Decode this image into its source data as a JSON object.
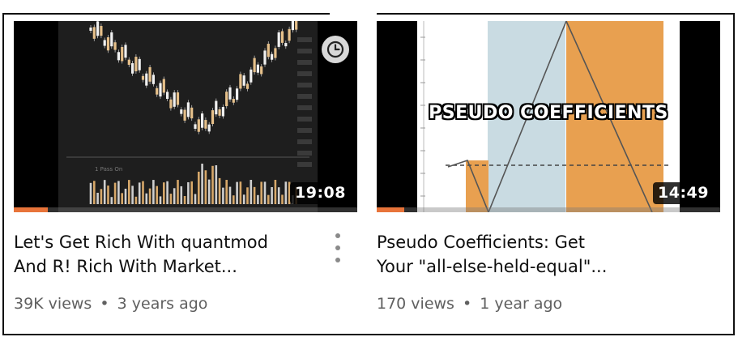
{
  "videos": [
    {
      "duration": "19:08",
      "title_line1": "Let's Get Rich With quantmod",
      "title_line2": "And R! Rich With Market...",
      "views": "39K views",
      "separator": "•",
      "age": "3 years ago",
      "watch_progress": 0.1,
      "chart_label": "1 Pass On"
    },
    {
      "duration": "14:49",
      "overlay_text": "PSEUDO COEFFICIENTS",
      "title_line1": "Pseudo Coefficients: Get",
      "title_line2": "Your \"all-else-held-equal\"...",
      "views": "170 views",
      "separator": "•",
      "age": "1 year ago",
      "watch_progress": 0.08
    }
  ],
  "colors": {
    "accent_orange": "#e8a050",
    "panel_blue": "#c9dbe2",
    "text_primary": "#0f0f0f",
    "text_secondary": "#606060"
  }
}
